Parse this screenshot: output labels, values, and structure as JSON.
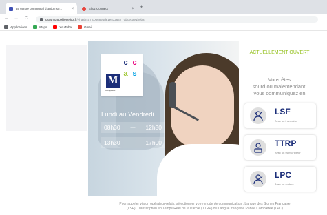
{
  "browser": {
    "tabs": [
      {
        "title": "Le centre communal d'action so...",
        "active": true,
        "favicon_color": "#3f51b5"
      },
      {
        "title": "Elioz Connect",
        "active": false,
        "favicon_color": "#e8453c"
      }
    ],
    "new_tab": "+",
    "close": "×",
    "nav": {
      "back": "←",
      "forward": "→",
      "reload": "C"
    },
    "url_host": "ccasmontpellier.elioz.fr",
    "url_rest": "/?hash=a7fc066894de1e532642 7abc9cae1b9ba",
    "bookmarks": [
      {
        "label": "Applications",
        "color": "#5f6368"
      },
      {
        "label": "Maps",
        "color": "#34a853"
      },
      {
        "label": "YouTube",
        "color": "#ff0000"
      },
      {
        "label": "Gmail",
        "color": "#ea4335"
      }
    ]
  },
  "logo": {
    "letter": "M",
    "cells": [
      {
        "letter": "c",
        "color": "#1b2e79"
      },
      {
        "letter": "c",
        "color": "#e8007d"
      },
      {
        "letter": "a",
        "color": "#95c11f"
      },
      {
        "letter": "s",
        "color": "#00a0e3"
      }
    ],
    "caption": "Montpellier"
  },
  "hours": {
    "days": "Lundi au Vendredi",
    "slots": [
      {
        "start": "08h30",
        "sep": "—",
        "end": "12h30"
      },
      {
        "start": "13h30",
        "sep": "—",
        "end": "17h00"
      }
    ]
  },
  "status": "ACTUELLEMENT OUVERT",
  "intro": [
    "Vous êtes",
    "sourd ou malentendant,",
    "vous communiquez en"
  ],
  "modes": [
    {
      "name": "LSF",
      "subtitle": "Avec un interprète",
      "icon": "interpreter-icon"
    },
    {
      "name": "TTRP",
      "subtitle": "Avec un transcripteur",
      "icon": "transcriber-icon"
    },
    {
      "name": "LPC",
      "subtitle": "Avec un codeur",
      "icon": "coder-icon"
    }
  ],
  "footer": {
    "line1": "Pour appeler via un opérateur-relais, sélectionner votre mode de communication : Langue des Signes Française",
    "line2": "(LSF), Transcription en Temps Réel de la Parole (TTRP) ou Langue française Parlée Complétée (LPC)"
  },
  "colors": {
    "accent_green": "#95c11f",
    "navy": "#1b2e79",
    "grey_text": "#8a8a8a"
  }
}
